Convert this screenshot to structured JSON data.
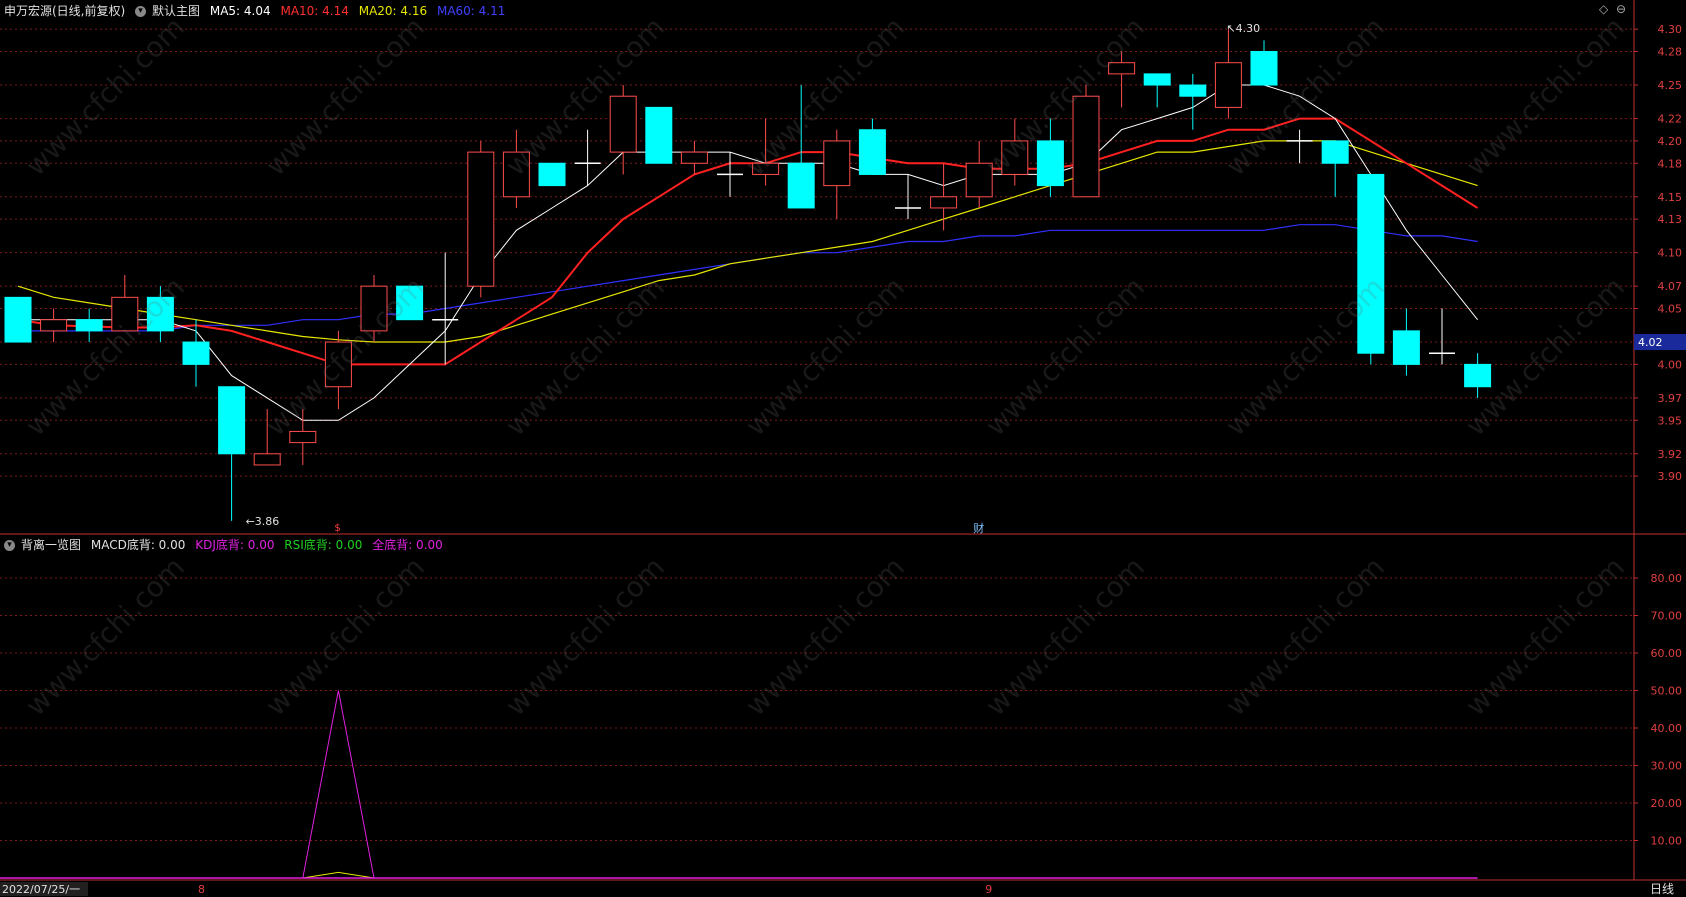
{
  "colors": {
    "up": "#ff4d4d",
    "down": "#00ffff",
    "ma5": "#ffffff",
    "ma10": "#ff2020",
    "ma20": "#e6e600",
    "ma60": "#3030ff",
    "grid": "#7a1a1a",
    "axis": "#c03030",
    "magenta": "#e020e0",
    "green": "#20d020"
  },
  "header": {
    "stock": "申万宏源(日线,前复权)",
    "main_chart": "默认主图",
    "ma5": "MA5: 4.04",
    "ma10": "MA10: 4.14",
    "ma20": "MA20: 4.16",
    "ma60": "MA60: 4.11"
  },
  "sub_header": {
    "title": "背离一览图",
    "macd": "MACD底背: 0.00",
    "kdj": "KDJ底背: 0.00",
    "rsi": "RSI底背: 0.00",
    "all": "全底背: 0.00"
  },
  "price_labels": {
    "low": "3.86",
    "high": "4.30",
    "current": "4.02"
  },
  "markers": {
    "cai": "财",
    "s": "$"
  },
  "date_axis": {
    "start": "2022/07/25/一",
    "m8": "8",
    "m9": "9",
    "period": "日线"
  },
  "watermark": "www.cfchi.com",
  "chart_data": {
    "type": "candlestick",
    "price_axis": {
      "ticks": [
        "4.30",
        "4.28",
        "4.25",
        "4.22",
        "4.20",
        "4.18",
        "4.15",
        "4.13",
        "4.10",
        "4.07",
        "4.05",
        "4.02",
        "4.00",
        "3.97",
        "3.95",
        "3.92",
        "3.90"
      ],
      "ylim": [
        3.85,
        4.31
      ]
    },
    "candles": [
      {
        "o": 4.06,
        "h": 4.06,
        "l": 4.02,
        "c": 4.02
      },
      {
        "o": 4.03,
        "h": 4.05,
        "l": 4.02,
        "c": 4.04
      },
      {
        "o": 4.04,
        "h": 4.05,
        "l": 4.02,
        "c": 4.03
      },
      {
        "o": 4.03,
        "h": 4.08,
        "l": 4.03,
        "c": 4.06
      },
      {
        "o": 4.06,
        "h": 4.07,
        "l": 4.02,
        "c": 4.03
      },
      {
        "o": 4.02,
        "h": 4.04,
        "l": 3.98,
        "c": 4.0
      },
      {
        "o": 3.98,
        "h": 3.98,
        "l": 3.86,
        "c": 3.92
      },
      {
        "o": 3.91,
        "h": 3.96,
        "l": 3.91,
        "c": 3.92
      },
      {
        "o": 3.93,
        "h": 3.96,
        "l": 3.91,
        "c": 3.94
      },
      {
        "o": 3.98,
        "h": 4.03,
        "l": 3.96,
        "c": 4.02
      },
      {
        "o": 4.03,
        "h": 4.08,
        "l": 4.02,
        "c": 4.07
      },
      {
        "o": 4.07,
        "h": 4.07,
        "l": 4.04,
        "c": 4.04
      },
      {
        "o": 4.04,
        "h": 4.1,
        "l": 4.0,
        "c": 4.04
      },
      {
        "o": 4.07,
        "h": 4.2,
        "l": 4.06,
        "c": 4.19
      },
      {
        "o": 4.15,
        "h": 4.21,
        "l": 4.14,
        "c": 4.19
      },
      {
        "o": 4.18,
        "h": 4.18,
        "l": 4.16,
        "c": 4.16
      },
      {
        "o": 4.18,
        "h": 4.21,
        "l": 4.16,
        "c": 4.18
      },
      {
        "o": 4.19,
        "h": 4.25,
        "l": 4.17,
        "c": 4.24
      },
      {
        "o": 4.23,
        "h": 4.23,
        "l": 4.18,
        "c": 4.18
      },
      {
        "o": 4.18,
        "h": 4.2,
        "l": 4.17,
        "c": 4.19
      },
      {
        "o": 4.17,
        "h": 4.19,
        "l": 4.15,
        "c": 4.17
      },
      {
        "o": 4.17,
        "h": 4.22,
        "l": 4.16,
        "c": 4.18
      },
      {
        "o": 4.18,
        "h": 4.25,
        "l": 4.14,
        "c": 4.14
      },
      {
        "o": 4.16,
        "h": 4.21,
        "l": 4.13,
        "c": 4.2
      },
      {
        "o": 4.21,
        "h": 4.22,
        "l": 4.17,
        "c": 4.17
      },
      {
        "o": 4.14,
        "h": 4.17,
        "l": 4.13,
        "c": 4.14
      },
      {
        "o": 4.14,
        "h": 4.18,
        "l": 4.12,
        "c": 4.15
      },
      {
        "o": 4.15,
        "h": 4.2,
        "l": 4.14,
        "c": 4.18
      },
      {
        "o": 4.17,
        "h": 4.22,
        "l": 4.16,
        "c": 4.2
      },
      {
        "o": 4.2,
        "h": 4.22,
        "l": 4.15,
        "c": 4.16
      },
      {
        "o": 4.15,
        "h": 4.25,
        "l": 4.15,
        "c": 4.24
      },
      {
        "o": 4.26,
        "h": 4.28,
        "l": 4.23,
        "c": 4.27
      },
      {
        "o": 4.26,
        "h": 4.26,
        "l": 4.23,
        "c": 4.25
      },
      {
        "o": 4.25,
        "h": 4.26,
        "l": 4.21,
        "c": 4.24
      },
      {
        "o": 4.23,
        "h": 4.3,
        "l": 4.22,
        "c": 4.27
      },
      {
        "o": 4.28,
        "h": 4.29,
        "l": 4.25,
        "c": 4.25
      },
      {
        "o": 4.2,
        "h": 4.21,
        "l": 4.18,
        "c": 4.2
      },
      {
        "o": 4.2,
        "h": 4.2,
        "l": 4.15,
        "c": 4.18
      },
      {
        "o": 4.17,
        "h": 4.17,
        "l": 4.0,
        "c": 4.01
      },
      {
        "o": 4.03,
        "h": 4.05,
        "l": 3.99,
        "c": 4.0
      },
      {
        "o": 4.01,
        "h": 4.05,
        "l": 4.0,
        "c": 4.01
      },
      {
        "o": 4.0,
        "h": 4.01,
        "l": 3.97,
        "c": 3.98
      }
    ],
    "ma5": [
      4.04,
      4.04,
      4.04,
      4.04,
      4.04,
      4.03,
      3.99,
      3.97,
      3.95,
      3.95,
      3.97,
      4.0,
      4.03,
      4.08,
      4.12,
      4.14,
      4.16,
      4.19,
      4.19,
      4.19,
      4.19,
      4.18,
      4.18,
      4.18,
      4.17,
      4.17,
      4.16,
      4.17,
      4.17,
      4.17,
      4.18,
      4.21,
      4.22,
      4.23,
      4.25,
      4.25,
      4.24,
      4.22,
      4.17,
      4.12,
      4.08,
      4.04
    ],
    "ma10": [
      4.04,
      4.035,
      4.034,
      4.033,
      4.033,
      4.035,
      4.03,
      4.02,
      4.01,
      4.0,
      4.0,
      4.0,
      4.0,
      4.02,
      4.04,
      4.06,
      4.1,
      4.13,
      4.15,
      4.17,
      4.18,
      4.18,
      4.19,
      4.19,
      4.185,
      4.18,
      4.18,
      4.175,
      4.175,
      4.175,
      4.18,
      4.19,
      4.2,
      4.2,
      4.21,
      4.21,
      4.22,
      4.22,
      4.2,
      4.18,
      4.16,
      4.14
    ],
    "ma20": [
      4.07,
      4.06,
      4.055,
      4.05,
      4.045,
      4.04,
      4.035,
      4.03,
      4.025,
      4.022,
      4.02,
      4.02,
      4.02,
      4.025,
      4.035,
      4.045,
      4.055,
      4.065,
      4.075,
      4.08,
      4.09,
      4.095,
      4.1,
      4.105,
      4.11,
      4.12,
      4.13,
      4.14,
      4.15,
      4.16,
      4.17,
      4.18,
      4.19,
      4.19,
      4.195,
      4.2,
      4.2,
      4.2,
      4.19,
      4.18,
      4.17,
      4.16
    ],
    "ma60": [
      4.03,
      4.03,
      4.03,
      4.03,
      4.03,
      4.035,
      4.035,
      4.035,
      4.04,
      4.04,
      4.045,
      4.045,
      4.05,
      4.055,
      4.06,
      4.065,
      4.07,
      4.075,
      4.08,
      4.085,
      4.09,
      4.095,
      4.1,
      4.1,
      4.105,
      4.11,
      4.11,
      4.115,
      4.115,
      4.12,
      4.12,
      4.12,
      4.12,
      4.12,
      4.12,
      4.12,
      4.125,
      4.125,
      4.12,
      4.115,
      4.115,
      4.11
    ],
    "indicator": {
      "axis_ticks": [
        "80.00",
        "70.00",
        "60.00",
        "50.00",
        "40.00",
        "30.00",
        "20.00",
        "10.00"
      ],
      "ylim": [
        0,
        88
      ],
      "spike": {
        "center_index": 9,
        "value": 50
      }
    }
  }
}
